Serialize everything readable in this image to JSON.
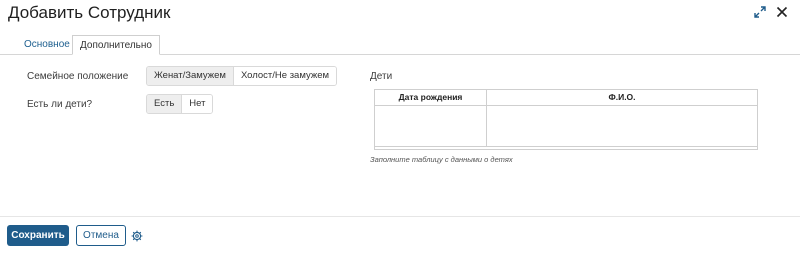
{
  "dialog": {
    "title": "Добавить Сотрудник"
  },
  "tabs": [
    {
      "label": "Основное",
      "active": false
    },
    {
      "label": "Дополнительно",
      "active": true
    }
  ],
  "fields": {
    "marital": {
      "label": "Семейное положение",
      "options": [
        "Женат/Замужем",
        "Холост/Не замужем"
      ],
      "selected": "Женат/Замужем"
    },
    "children": {
      "label": "Есть ли дети?",
      "options": [
        "Есть",
        "Нет"
      ],
      "selected": "Есть"
    }
  },
  "kids": {
    "title": "Дети",
    "columns": [
      "Дата рождения",
      "Ф.И.О."
    ],
    "rows": [],
    "hint": "Заполните таблицу с данными о детях"
  },
  "footer": {
    "save_label": "Сохранить",
    "cancel_label": "Отмена"
  },
  "icons": {
    "expand": "expand-icon",
    "close": "close-icon",
    "settings": "gear-icon"
  },
  "colors": {
    "primary": "#1f5c8b",
    "active_tab_text": "#1d5f8f"
  }
}
